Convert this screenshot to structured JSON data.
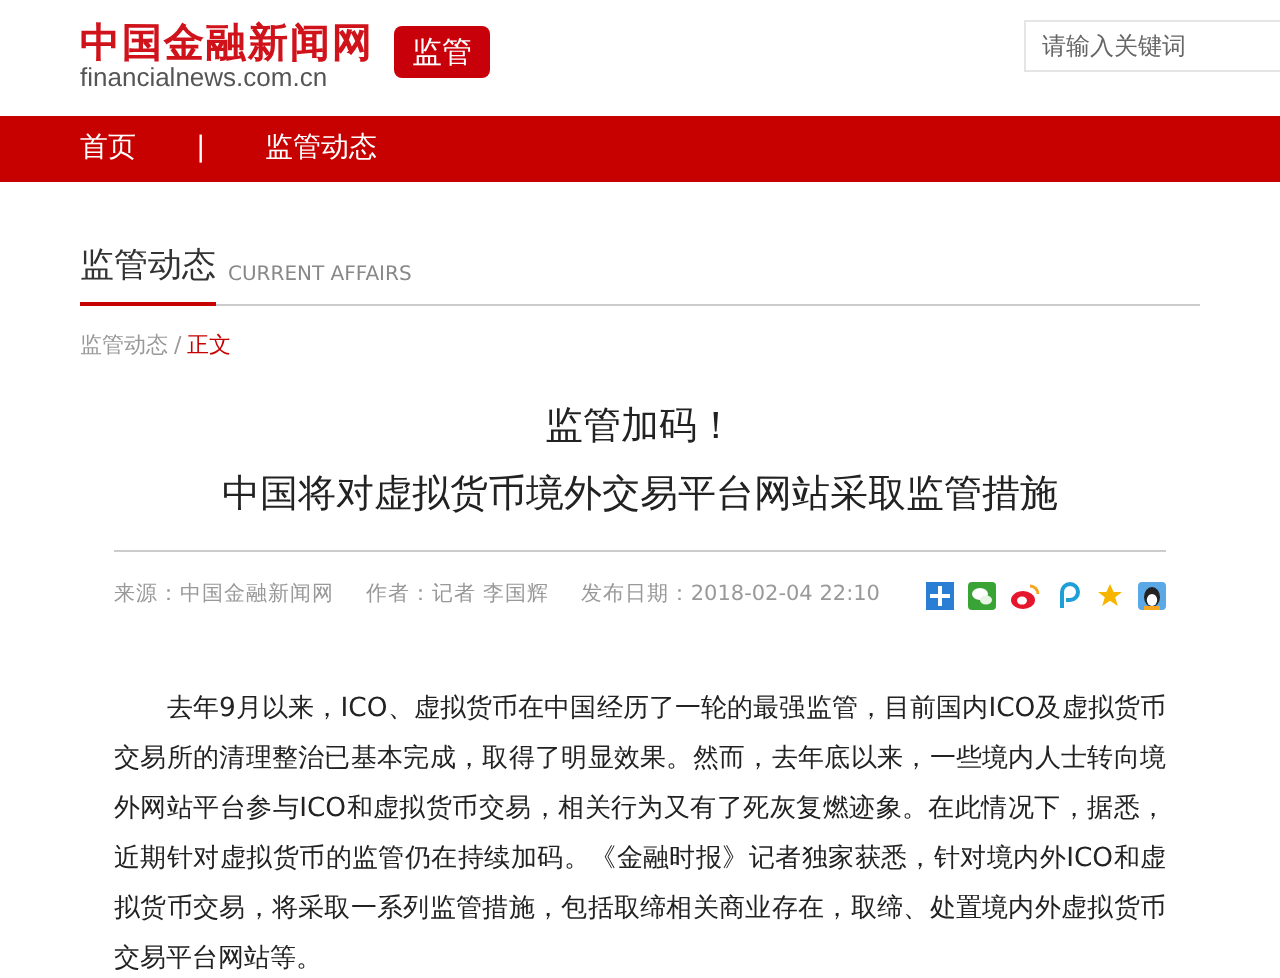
{
  "header": {
    "logo_title": "中国金融新闻网",
    "logo_domain": "financialnews.com.cn",
    "channel_badge": "监管",
    "search": {
      "placeholder": "请输入关键词"
    }
  },
  "nav": {
    "items": [
      {
        "label": "首页"
      },
      {
        "label": "|"
      },
      {
        "label": "监管动态"
      }
    ]
  },
  "section": {
    "title": "监管动态",
    "subtitle": "CURRENT AFFAIRS"
  },
  "breadcrumb": [
    {
      "label": "监管动态",
      "selected": false
    },
    {
      "label": "/",
      "selected": false
    },
    {
      "label": "正文",
      "selected": true
    }
  ],
  "article": {
    "title_lines": [
      "监管加码！",
      "中国将对虚拟货币境外交易平台网站采取监管措施"
    ],
    "meta": [
      "来源：中国金融新闻网",
      "作者：记者 李国辉",
      "发布日期：2018-02-04 22:10"
    ],
    "share": [
      {
        "kind": "plus"
      },
      {
        "kind": "wechat"
      },
      {
        "kind": "weibo"
      },
      {
        "kind": "p"
      },
      {
        "kind": "star"
      },
      {
        "kind": "qq"
      }
    ],
    "body": "去年9月以来，ICO、虚拟货币在中国经历了一轮的最强监管，目前国内ICO及虚拟货币交易所的清理整治已基本完成，取得了明显效果。然而，去年底以来，一些境内人士转向境外网站平台参与ICO和虚拟货币交易，相关行为又有了死灰复燃迹象。在此情况下，据悉，近期针对虚拟货币的监管仍在持续加码。《金融时报》记者独家获悉，针对境内外ICO和虚拟货币交易，将采取一系列监管措施，包括取缔相关商业存在，取缔、处置境内外虚拟货币交易平台网站等。"
  }
}
